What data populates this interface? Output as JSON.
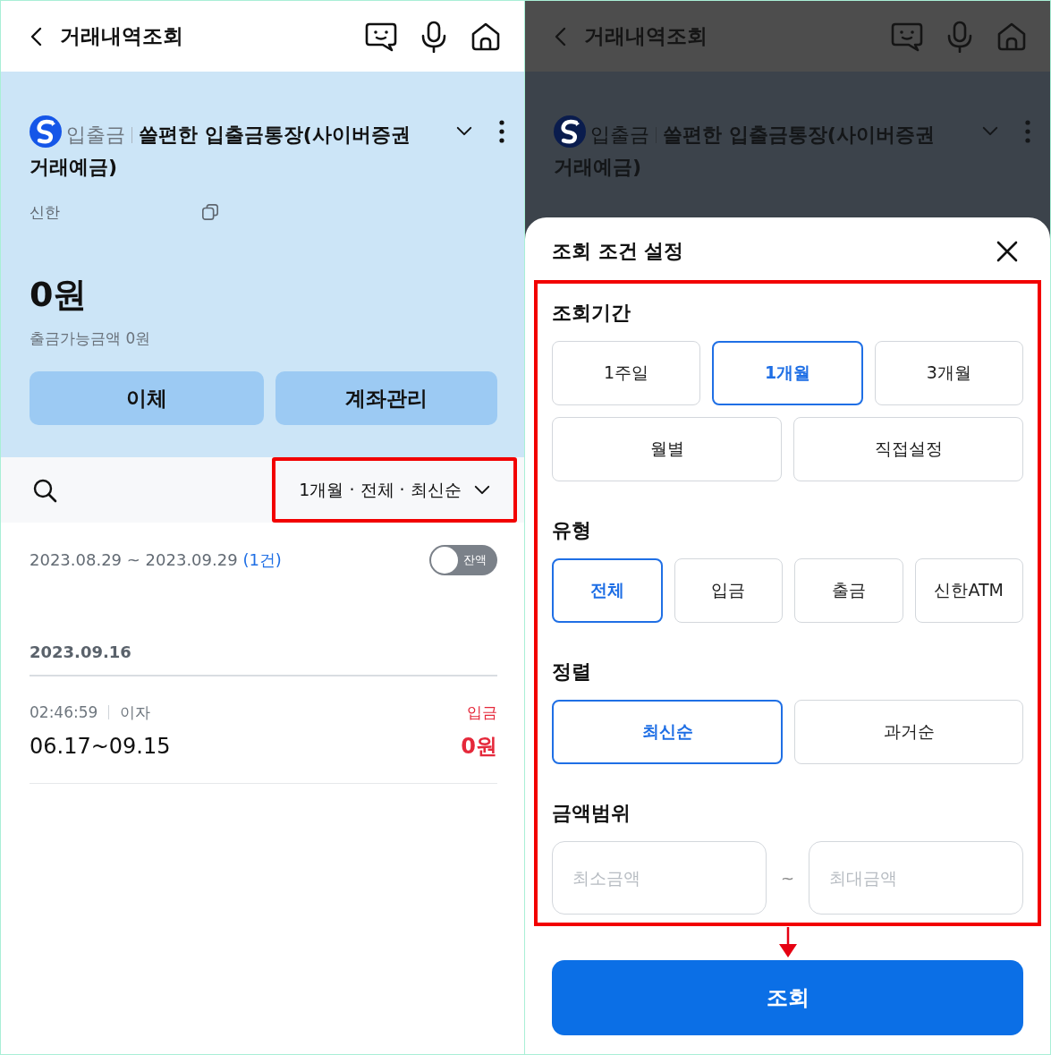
{
  "list_screen": {
    "header": {
      "title": "거래내역조회"
    },
    "account": {
      "type": "입출금",
      "name_lines": [
        "쓸편한 입출금통장(사이버증권",
        "거래예금)"
      ],
      "bank": "신한",
      "balance": "0원",
      "available": "출금가능금액 0원"
    },
    "actions": [
      "이체",
      "계좌관리"
    ],
    "filter": {
      "label": "1개월 · 전체 · 최신순",
      "highlighted": true
    },
    "range": {
      "period": "2023.08.29 ~ 2023.09.29",
      "count": "(1건)"
    },
    "balance_toggle": {
      "label": "잔액",
      "on": false
    },
    "groups": [
      {
        "date": "2023.09.16",
        "transactions": [
          {
            "time": "02:46:59",
            "category": "이자",
            "memo": "06.17~09.15",
            "type": "입금",
            "amount": "0원",
            "color": "#e5283a"
          }
        ]
      }
    ]
  },
  "filter_screen": {
    "header": {
      "title": "거래내역조회"
    },
    "account": {
      "type": "입출금",
      "name_lines": [
        "쓸편한 입출금통장(사이버증권",
        "거래예금)"
      ]
    },
    "sheet": {
      "title": "조회 조건 설정",
      "highlighted": true,
      "sections": [
        {
          "title": "조회기간",
          "kind": "options",
          "option_rows": [
            [
              {
                "label": "1주일",
                "selected": false
              },
              {
                "label": "1개월",
                "selected": true
              },
              {
                "label": "3개월",
                "selected": false
              }
            ],
            [
              {
                "label": "월별",
                "selected": false
              },
              {
                "label": "직접설정",
                "selected": false
              }
            ]
          ]
        },
        {
          "title": "유형",
          "kind": "options",
          "option_rows": [
            [
              {
                "label": "전체",
                "selected": true
              },
              {
                "label": "입금",
                "selected": false
              },
              {
                "label": "출금",
                "selected": false
              },
              {
                "label": "신한ATM",
                "selected": false
              }
            ]
          ]
        },
        {
          "title": "정렬",
          "kind": "options",
          "option_rows": [
            [
              {
                "label": "최신순",
                "selected": true
              },
              {
                "label": "과거순",
                "selected": false
              }
            ]
          ]
        },
        {
          "title": "금액범위",
          "kind": "range",
          "fields": [
            {
              "placeholder": "최소금액"
            },
            {
              "placeholder": "최대금액"
            }
          ],
          "separator": "~"
        }
      ],
      "submit": "조회"
    }
  }
}
